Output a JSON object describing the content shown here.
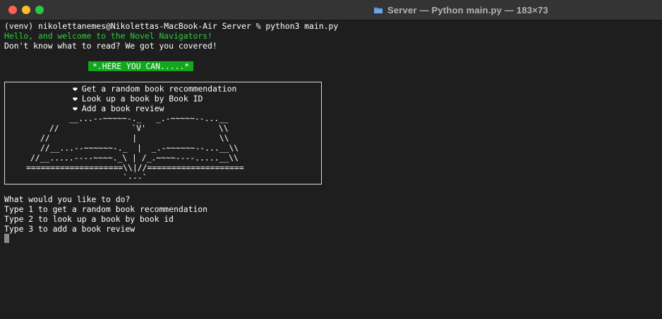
{
  "window": {
    "title": "Server — Python main.py — 183×73"
  },
  "terminal": {
    "prompt_line": "(venv) nikolettanemes@Nikolettas-MacBook-Air Server % python3 main.py",
    "welcome_line": "Hello, and welcome to the Novel Navigators!",
    "tagline": "Don't know what to read? We got you covered!",
    "banner": "*.HERE YOU CAN.....*",
    "menu_items": [
      "Get a random book recommendation",
      "Look up a book by Book ID",
      "Add a book review"
    ],
    "art_lines": [
      "   __...--~~~~~-._   _.-~~~~~--...__",
      " //               `V'               \\\\",
      "//                 |                 \\\\",
      "//__...--~~~~~~-._  |  _.-~~~~~~--...__\\\\",
      "//__.....----~~~~._\\ | /_.~~~~----.....__\\\\",
      "====================\\\\|//====================",
      "                    `---`"
    ],
    "question": "What would you like to do?",
    "options": [
      "Type 1 to get a random book recommendation",
      "Type 2 to look up a book by book id",
      "Type 3 to add a book review"
    ]
  },
  "colors": {
    "background": "#1e1e1e",
    "green_text": "#2ecc40",
    "banner_bg": "#11a81c",
    "cursor": "#8a8a8a"
  },
  "icons": {
    "heart": "heart-icon",
    "folder": "folder-icon"
  }
}
